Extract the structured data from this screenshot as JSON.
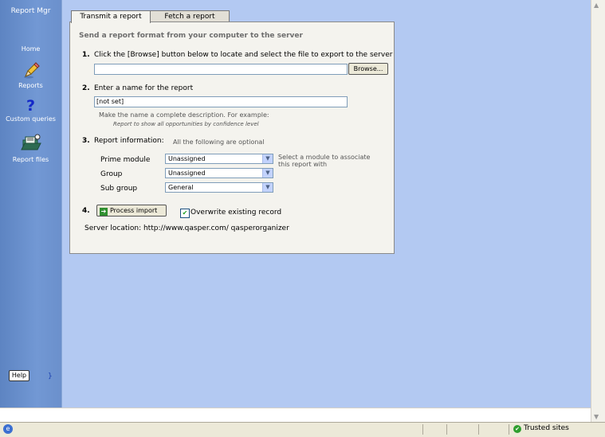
{
  "sidebar": {
    "title": "Report Mgr",
    "items": [
      {
        "label": "Home",
        "icon": "home-icon"
      },
      {
        "label": "Reports",
        "icon": "pencil-icon"
      },
      {
        "label": "Custom queries",
        "icon": "question-icon",
        "glyph": "?"
      },
      {
        "label": "Report files",
        "icon": "report-files-icon"
      }
    ],
    "help_label": "Help",
    "collapse_glyph": "}"
  },
  "tabs": [
    {
      "label": "Transmit a report",
      "active": true
    },
    {
      "label": "Fetch a report",
      "active": false
    }
  ],
  "form": {
    "heading": "Send a report format from your computer to the server",
    "step1": {
      "num": "1.",
      "text": "Click the [Browse] button below to locate and select the file to export to the server",
      "file_value": "",
      "browse_label": "Browse..."
    },
    "step2": {
      "num": "2.",
      "text": "Enter a name for the report",
      "name_value": "[not set]",
      "hint": "Make the name a complete description. For example:",
      "example": "Report to show all opportunities by confidence level"
    },
    "step3": {
      "num": "3.",
      "text": "Report information:",
      "optional_note": "All the following are optional",
      "fields": [
        {
          "label": "Prime module",
          "value": "Unassigned"
        },
        {
          "label": "Group",
          "value": "Unassigned"
        },
        {
          "label": "Sub group",
          "value": "General"
        }
      ],
      "module_hint": "Select a module to associate this report with"
    },
    "step4": {
      "num": "4.",
      "process_label": "Process import",
      "overwrite_label": "Overwrite existing record",
      "overwrite_checked": true
    },
    "server_location": "Server location: http://www.qasper.com/ qasperorganizer"
  },
  "statusbar": {
    "zone": "Trusted sites"
  }
}
